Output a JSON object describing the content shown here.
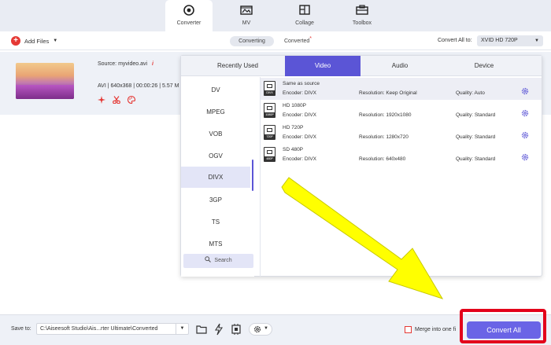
{
  "top_nav": {
    "tabs": [
      {
        "label": "Converter",
        "icon": "converter-icon",
        "active": true
      },
      {
        "label": "MV",
        "icon": "mv-icon"
      },
      {
        "label": "Collage",
        "icon": "collage-icon"
      },
      {
        "label": "Toolbox",
        "icon": "toolbox-icon"
      }
    ]
  },
  "toolbar": {
    "add_files": "Add Files",
    "converting": "Converting",
    "converted": "Converted",
    "converted_dot": "*",
    "convert_all_to_label": "Convert All to:",
    "convert_all_to_value": "XVID HD 720P"
  },
  "file": {
    "source": "Source: myvideo.avi",
    "meta": "AVI | 640x368 | 00:00:26 | 5.57 M"
  },
  "format_panel": {
    "tabs": [
      "Recently Used",
      "Video",
      "Audio",
      "Device"
    ],
    "active_tab": "Video",
    "formats": [
      "DV",
      "MPEG",
      "VOB",
      "OGV",
      "DIVX",
      "3GP",
      "TS",
      "MTS"
    ],
    "active_format": "DIVX",
    "search_label": "Search",
    "profiles": [
      {
        "name": "Same as source",
        "encoder": "Encoder: DIVX",
        "resolution": "Resolution: Keep Original",
        "quality": "Quality: Auto",
        "tag": "DIVX"
      },
      {
        "name": "HD 1080P",
        "encoder": "Encoder: DIVX",
        "resolution": "Resolution: 1920x1080",
        "quality": "Quality: Standard",
        "tag": "1080P"
      },
      {
        "name": "HD 720P",
        "encoder": "Encoder: DIVX",
        "resolution": "Resolution: 1280x720",
        "quality": "Quality: Standard",
        "tag": "720P"
      },
      {
        "name": "SD 480P",
        "encoder": "Encoder: DIVX",
        "resolution": "Resolution: 640x480",
        "quality": "Quality: Standard",
        "tag": "480P"
      }
    ]
  },
  "bottom": {
    "save_to_label": "Save to:",
    "save_path": "C:\\Aiseesoft Studio\\Ais...rter Ultimate\\Converted",
    "merge_label": "Merge into one fi",
    "convert_all": "Convert All"
  },
  "colors": {
    "accent": "#5b55d6",
    "highlight": "#e3001b",
    "arrow": "#ffff00"
  }
}
